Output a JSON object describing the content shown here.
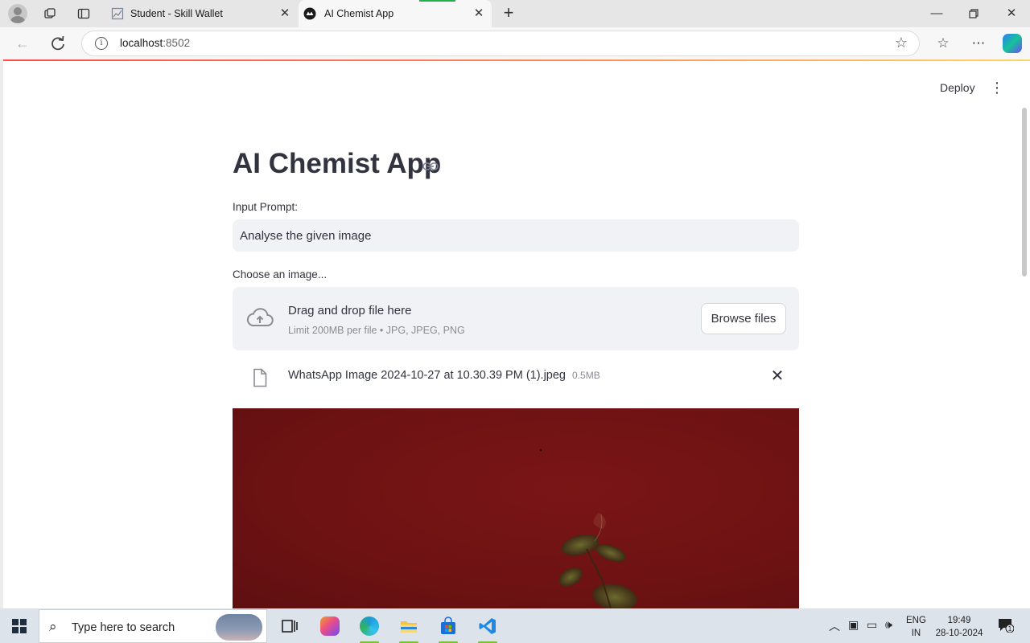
{
  "browser": {
    "tabs": [
      {
        "title": "Student - Skill Wallet",
        "icon": "chart-favicon-icon",
        "active": false
      },
      {
        "title": "AI Chemist App",
        "icon": "streamlit-favicon-icon",
        "active": true
      }
    ],
    "address": {
      "host": "localhost",
      "port": ":8502"
    }
  },
  "app": {
    "deploy_label": "Deploy",
    "title": "AI Chemist App",
    "prompt": {
      "label": "Input Prompt:",
      "value": "Analyse the given image"
    },
    "uploader": {
      "label": "Choose an image...",
      "drop_title": "Drag and drop file here",
      "limit_text": "Limit 200MB per file • JPG, JPEG, PNG",
      "browse_label": "Browse files"
    },
    "file": {
      "name": "WhatsApp Image 2024-10-27 at 10.30.39 PM (1).jpeg",
      "size": "0.5MB"
    }
  },
  "taskbar": {
    "search_placeholder": "Type here to search",
    "lang_top": "ENG",
    "lang_bottom": "IN",
    "time": "19:49",
    "date": "28-10-2024",
    "notification_count": "1"
  },
  "colors": {
    "accent_red": "#ff4b4b",
    "input_bg": "#f0f2f6",
    "text": "#31333f",
    "preview_red": "#6d1213"
  }
}
